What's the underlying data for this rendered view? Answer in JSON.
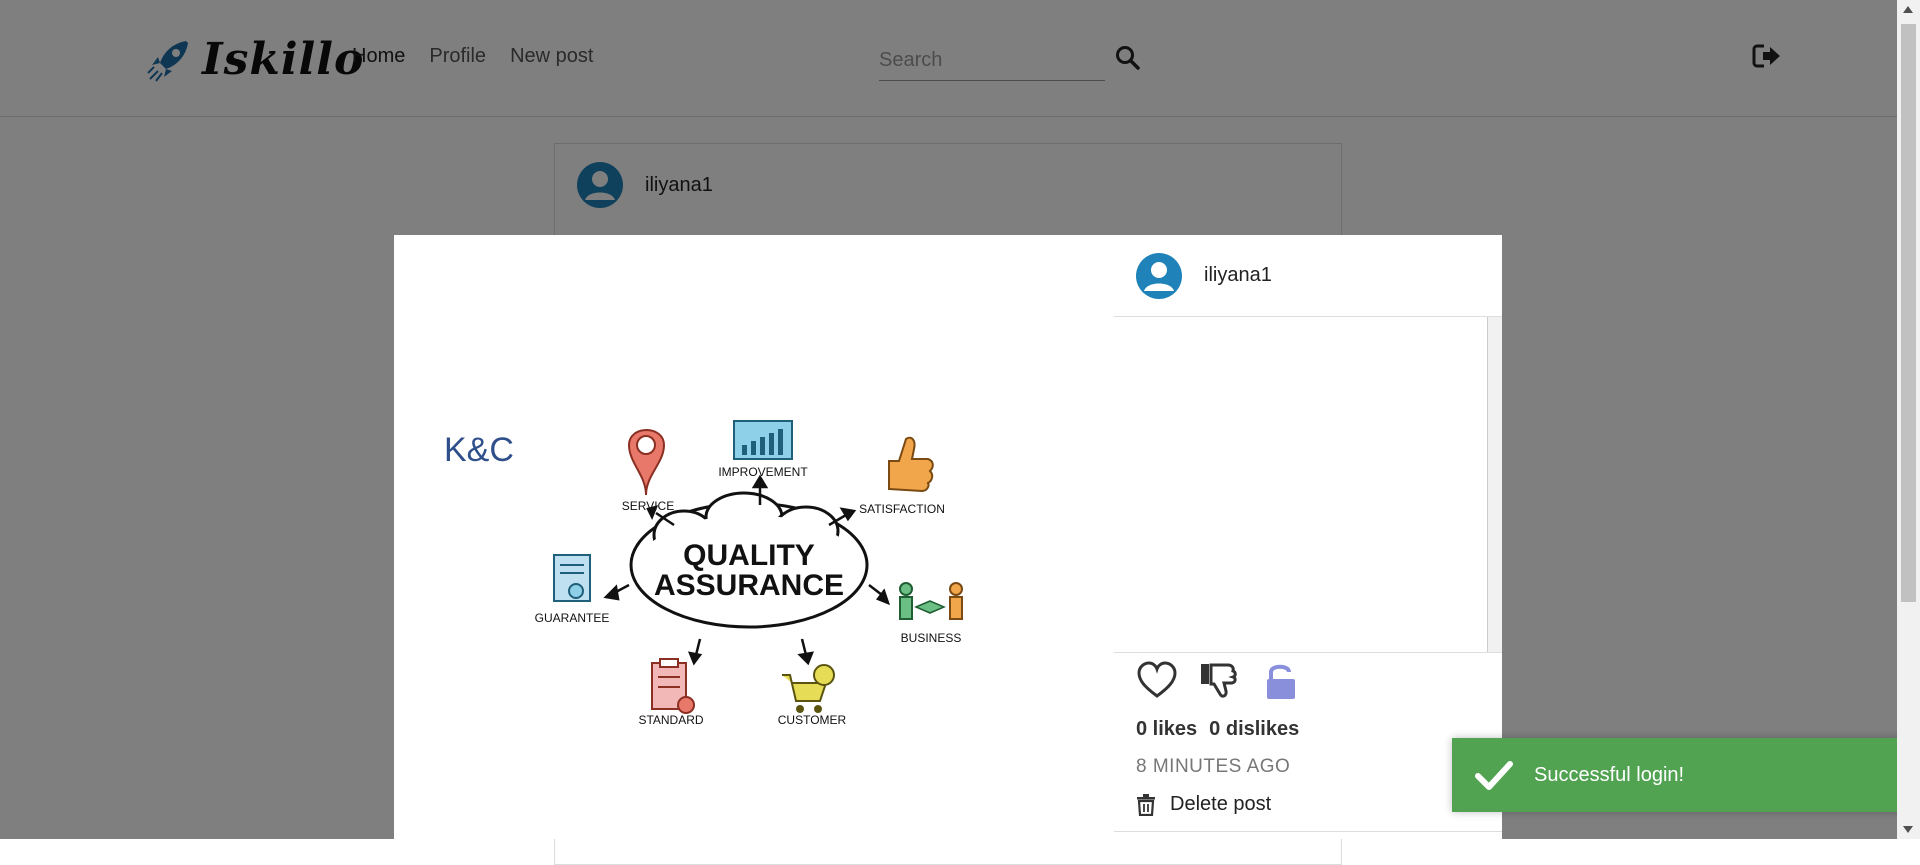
{
  "brand": {
    "name": "Iskillo"
  },
  "nav": {
    "links": [
      {
        "label": "Home",
        "active": true
      },
      {
        "label": "Profile",
        "active": false
      },
      {
        "label": "New post",
        "active": false
      }
    ]
  },
  "search": {
    "placeholder": "Search",
    "value": ""
  },
  "icons": {
    "logo": "rocket-icon",
    "search": "search-icon",
    "logout": "sign-out-icon",
    "avatar": "user-avatar-icon",
    "like": "heart-icon",
    "dislike": "thumbs-down-icon",
    "privacy": "unlock-icon",
    "delete": "trash-icon",
    "toast": "check-icon"
  },
  "feed": {
    "post": {
      "username": "iliyana1"
    }
  },
  "modal": {
    "username": "iliyana1",
    "likes_label": "0 likes",
    "dislikes_label": "0 dislikes",
    "time_ago": "8 MINUTES AGO",
    "delete_label": "Delete post",
    "image": {
      "brand_mark": "K&C",
      "center_line1": "QUALITY",
      "center_line2": "ASSURANCE",
      "labels": {
        "service": "SERVICE",
        "improvement": "IMPROVEMENT",
        "satisfaction": "SATISFACTION",
        "guarantee": "GUARANTEE",
        "business": "BUSINESS",
        "standard": "STANDARD",
        "customer": "CUSTOMER"
      }
    }
  },
  "toast": {
    "message": "Successful login!"
  },
  "colors": {
    "toast_bg": "#51a351",
    "avatar": "#1f82b8",
    "privacy_icon": "#8a8fdc",
    "backdrop": "rgba(0,0,0,0.5)"
  }
}
